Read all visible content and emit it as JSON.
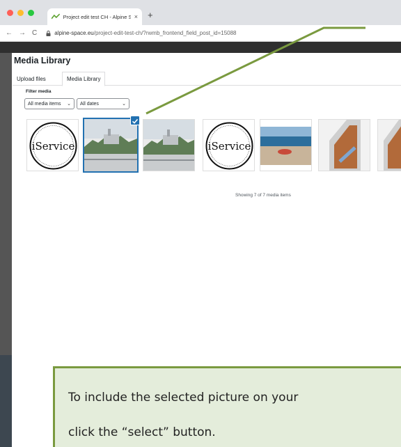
{
  "browser": {
    "tab_title": "Project edit test CH - Alpine S",
    "tab_close": "×",
    "new_tab": "+",
    "back": "←",
    "forward": "→",
    "reload": "C",
    "url_host": "alpine-space.eu",
    "url_path": "/project-edit-test-ch/?rwmb_frontend_field_post_id=15088"
  },
  "modal": {
    "title": "Media Library",
    "tabs": [
      {
        "label": "Upload files"
      },
      {
        "label": "Media Library"
      }
    ],
    "filter_label": "Filter media",
    "filter_type": "All media items",
    "filter_date": "All dates",
    "thumbnails": [
      {
        "kind": "iservice-logo",
        "label": "iService",
        "selected": false
      },
      {
        "kind": "castle-photo",
        "selected": true
      },
      {
        "kind": "castle-photo",
        "selected": false
      },
      {
        "kind": "iservice-logo",
        "label": "iService",
        "selected": false
      },
      {
        "kind": "beach-photo",
        "selected": false
      },
      {
        "kind": "interior-photo",
        "selected": false
      },
      {
        "kind": "interior-photo",
        "selected": false
      }
    ],
    "status": "Showing 7 of 7 media items"
  },
  "callout": {
    "line1": "To include the selected picture on your",
    "line2": "click the “select” button."
  },
  "colors": {
    "accent": "#2271b1",
    "callout_bg": "#e4eddb",
    "callout_border": "#7a9a3f"
  }
}
